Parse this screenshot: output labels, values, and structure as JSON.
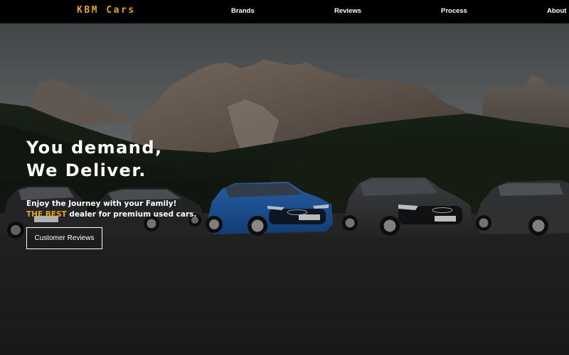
{
  "navbar": {
    "brand": "KBM Cars",
    "links": [
      "Brands",
      "Reviews",
      "Process",
      "About"
    ]
  },
  "hero": {
    "headline_line1": "You demand,",
    "headline_line2": "We Deliver.",
    "sub_line1": "Enjoy the Journey with your Family!",
    "sub_highlight": "THE BEST",
    "sub_line2_rest": " dealer for premium used cars.",
    "cta_label": "Customer Reviews"
  },
  "colors": {
    "accent": "#e5a321",
    "navbar_bg": "#000000",
    "text": "#ffffff",
    "featured_car": "#1f5fb0"
  },
  "icons": [
    "audi-rings-logo"
  ]
}
